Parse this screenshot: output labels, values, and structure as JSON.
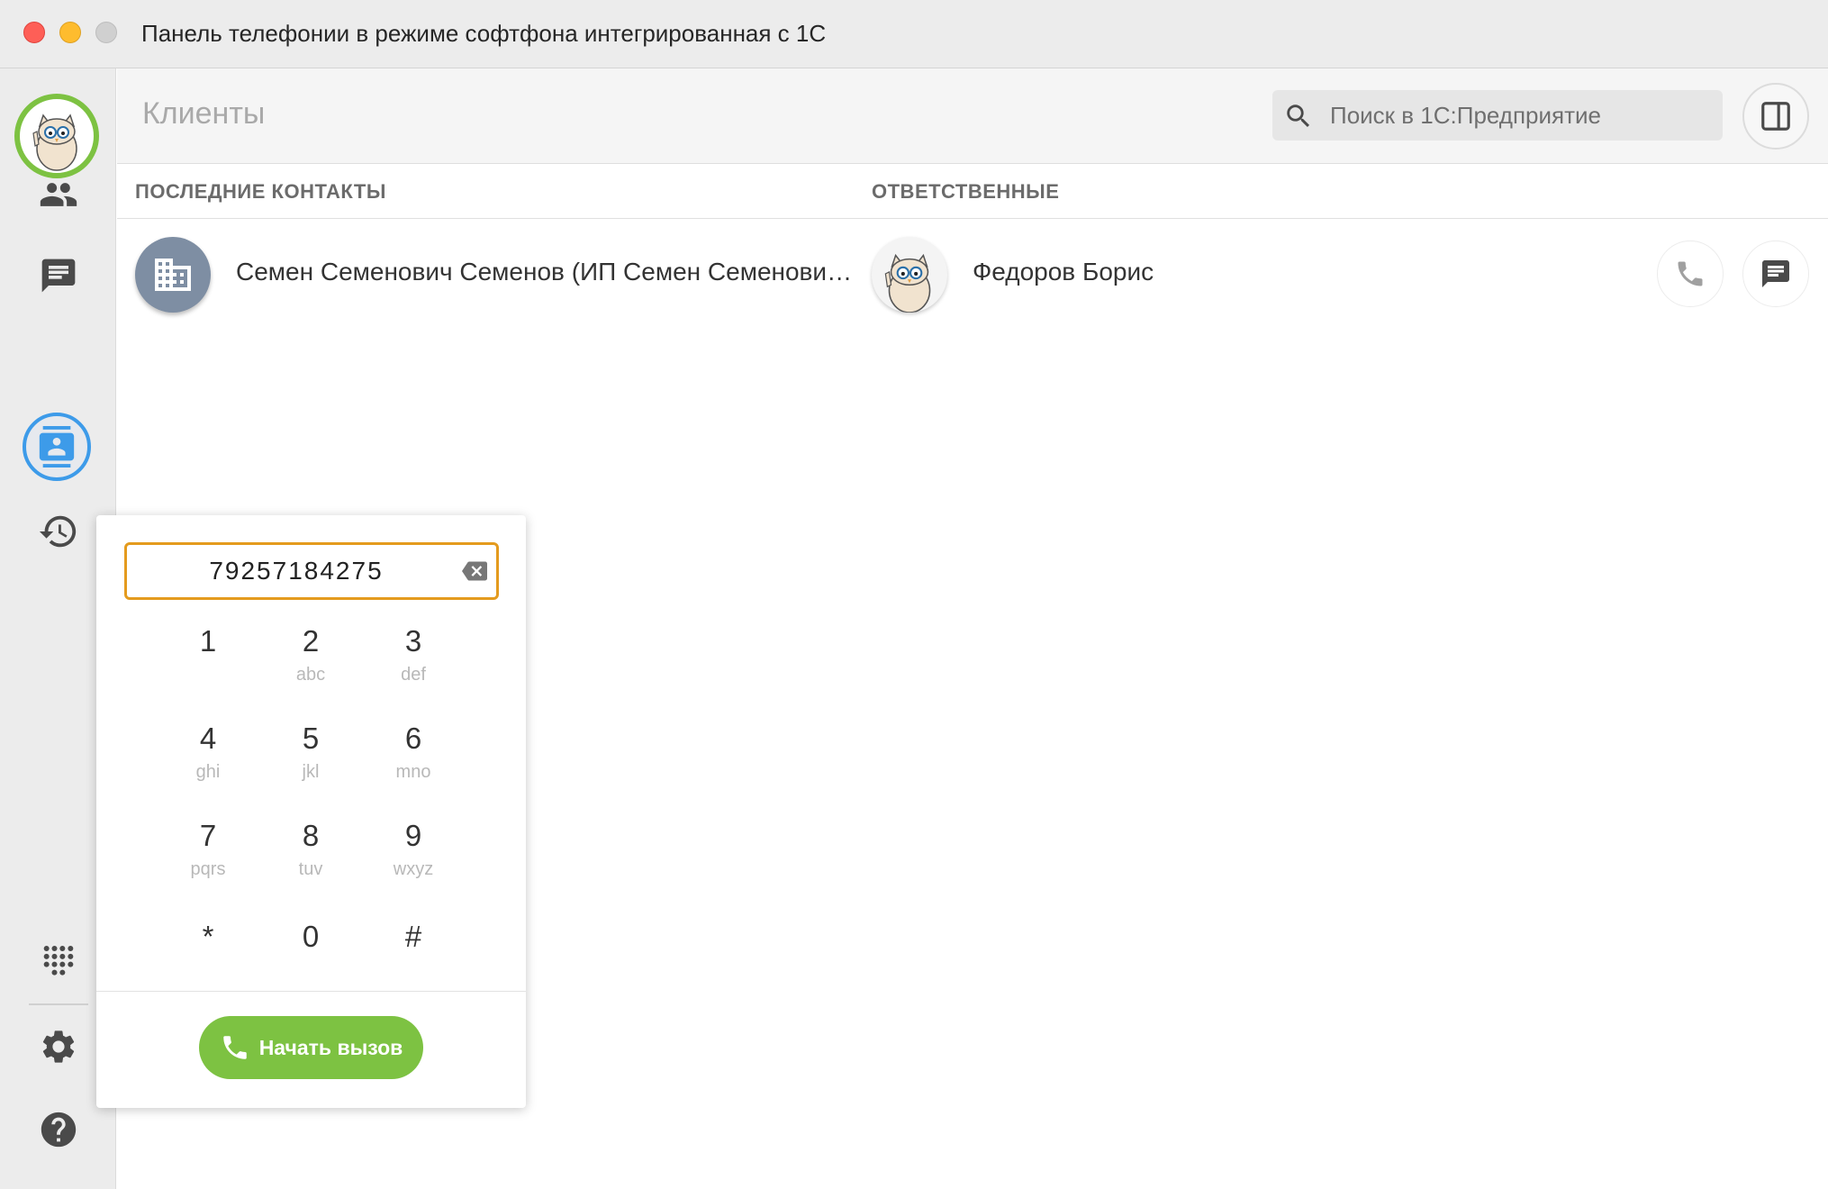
{
  "window": {
    "title": "Панель телефонии в режиме софтфона интегрированная с 1С"
  },
  "header": {
    "title": "Клиенты",
    "search_placeholder": "Поиск в 1С:Предприятие"
  },
  "columns": {
    "recent": "ПОСЛЕДНИЕ КОНТАКТЫ",
    "responsible": "ОТВЕТСТВЕННЫЕ"
  },
  "contacts": [
    {
      "name": "Семен Семенович Семенов (ИП Семен Семенович Семенов)",
      "responsible": "Федоров Борис"
    }
  ],
  "sidebar": {
    "items": [
      {
        "icon": "people-icon"
      },
      {
        "icon": "chat-icon"
      },
      {
        "icon": "contacts-icon",
        "active": true
      },
      {
        "icon": "history-icon"
      },
      {
        "icon": "dialpad-icon"
      },
      {
        "icon": "gear-icon"
      },
      {
        "icon": "help-icon"
      }
    ]
  },
  "dialpad": {
    "number": "79257184275",
    "keys": [
      {
        "digit": "1",
        "letters": ""
      },
      {
        "digit": "2",
        "letters": "abc"
      },
      {
        "digit": "3",
        "letters": "def"
      },
      {
        "digit": "4",
        "letters": "ghi"
      },
      {
        "digit": "5",
        "letters": "jkl"
      },
      {
        "digit": "6",
        "letters": "mno"
      },
      {
        "digit": "7",
        "letters": "pqrs"
      },
      {
        "digit": "8",
        "letters": "tuv"
      },
      {
        "digit": "9",
        "letters": "wxyz"
      },
      {
        "digit": "*",
        "letters": ""
      },
      {
        "digit": "0",
        "letters": ""
      },
      {
        "digit": "#",
        "letters": ""
      }
    ],
    "call_label": "Начать вызов"
  },
  "colors": {
    "accent_green": "#7dc242",
    "active_blue": "#3d9be9",
    "input_border": "#e49b1e",
    "client_avatar": "#7e8ea3"
  }
}
